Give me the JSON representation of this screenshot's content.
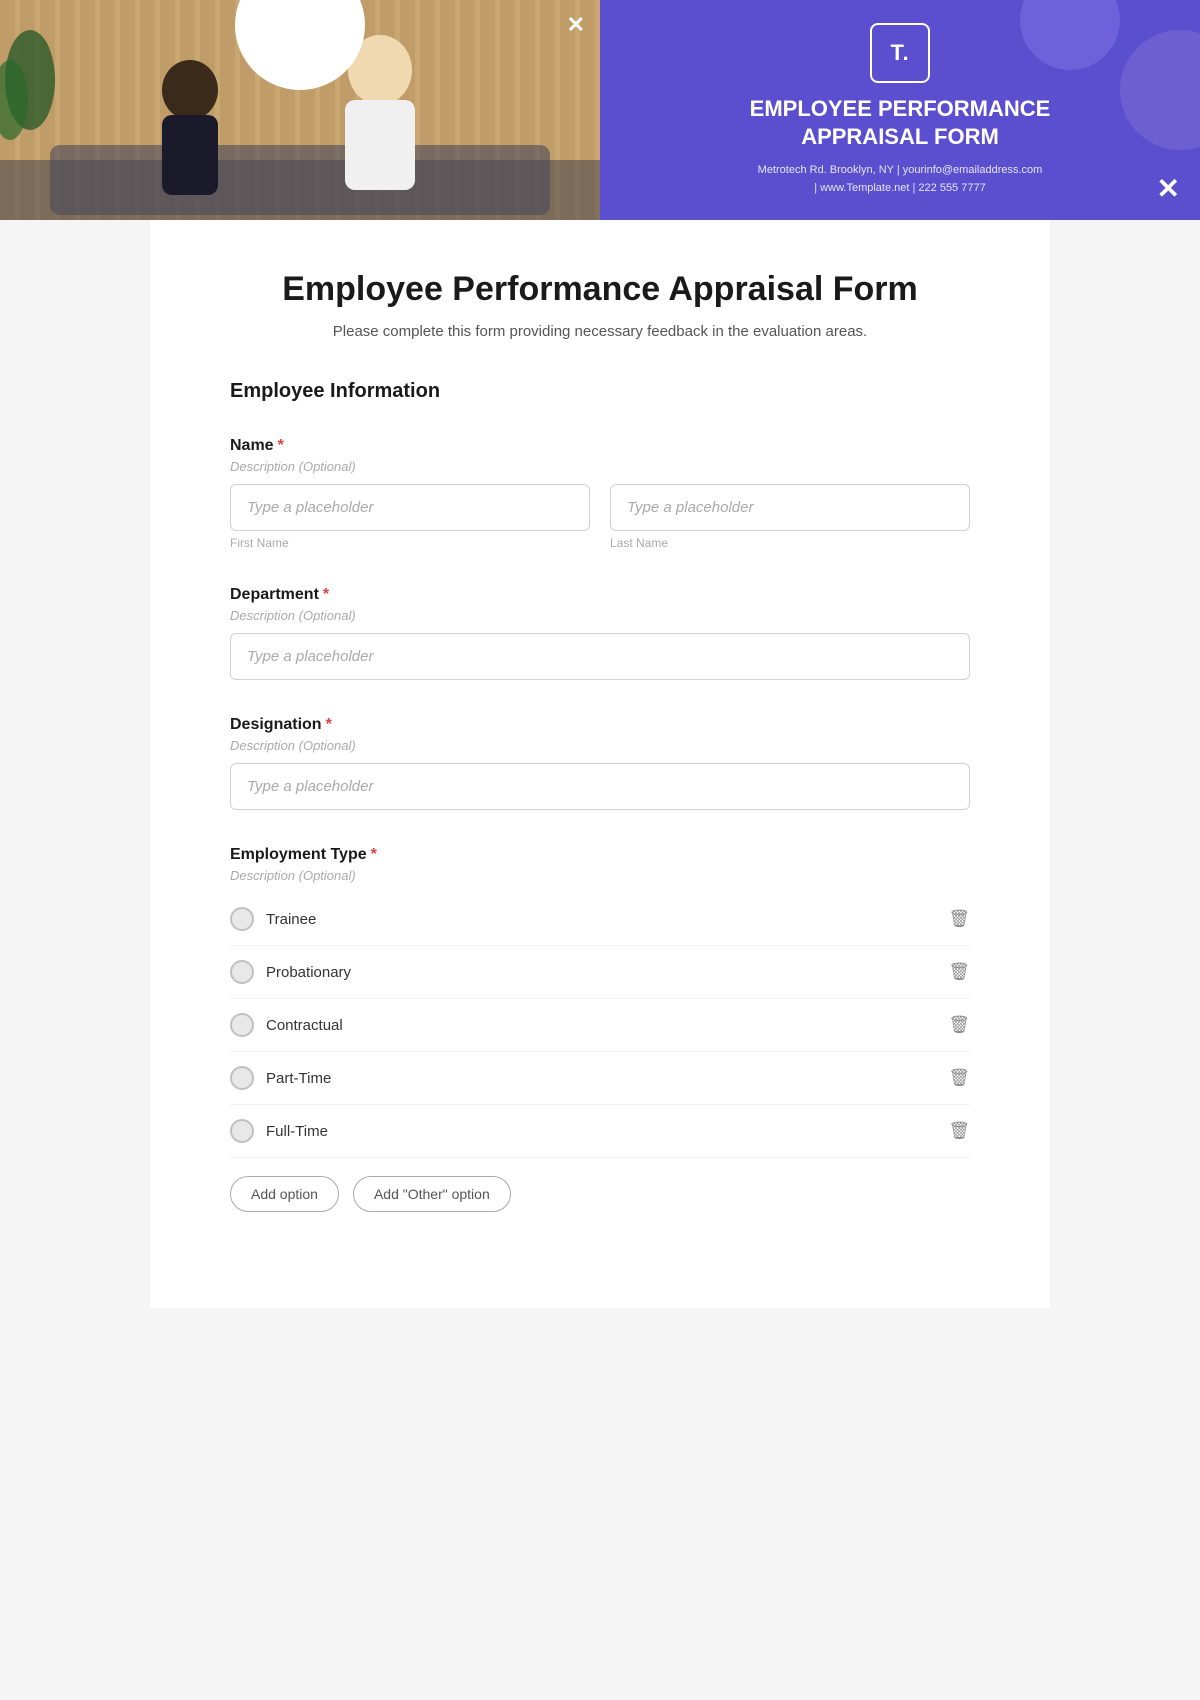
{
  "header": {
    "logo_text": "T.",
    "title_line1": "EMPLOYEE PERFORMANCE",
    "title_line2": "APPRAISAL FORM",
    "contact_line1": "Metrotech Rd. Brooklyn, NY  |  yourinfo@emailaddress.com",
    "contact_line2": "| www.Template.net  |  222 555 7777",
    "close_icon_label": "✕",
    "photo_close_label": "✕"
  },
  "form": {
    "main_title": "Employee Performance Appraisal Form",
    "subtitle": "Please complete this form providing necessary feedback in the evaluation areas.",
    "section_employee_info": "Employee Information",
    "fields": {
      "name": {
        "label": "Name",
        "required": true,
        "description": "Description (Optional)",
        "first_name_placeholder": "Type a placeholder",
        "last_name_placeholder": "Type a placeholder",
        "first_name_sublabel": "First Name",
        "last_name_sublabel": "Last Name"
      },
      "department": {
        "label": "Department",
        "required": true,
        "description": "Description (Optional)",
        "placeholder": "Type a placeholder"
      },
      "designation": {
        "label": "Designation",
        "required": true,
        "description": "Description (Optional)",
        "placeholder": "Type a placeholder"
      },
      "employment_type": {
        "label": "Employment Type",
        "required": true,
        "description": "Description (Optional)",
        "options": [
          "Trainee",
          "Probationary",
          "Contractual",
          "Part-Time",
          "Full-Time"
        ],
        "add_option_label": "Add option",
        "add_other_label": "Add \"Other\" option"
      }
    }
  }
}
